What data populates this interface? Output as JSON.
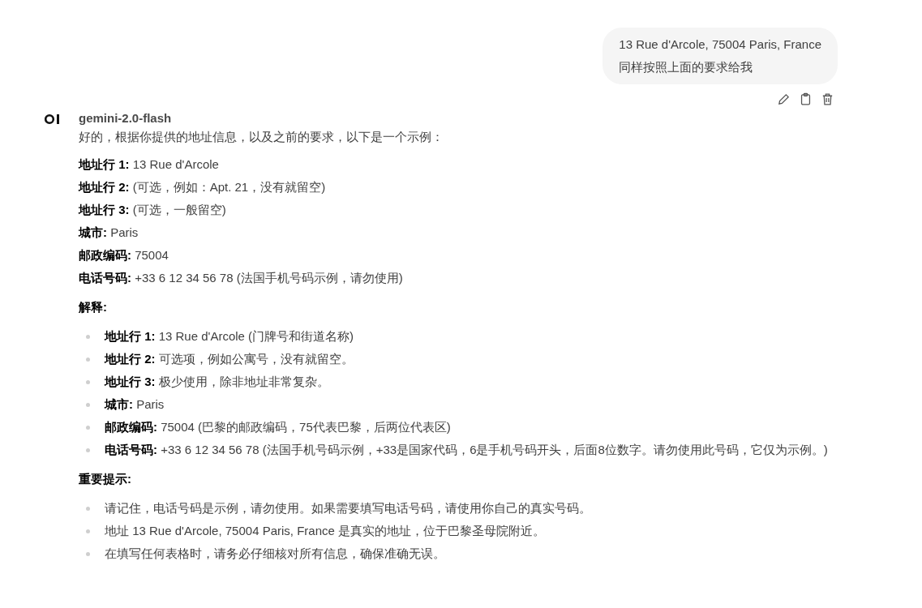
{
  "user_message": {
    "lines": [
      "13 Rue d'Arcole, 75004 Paris, France",
      "同样按照上面的要求给我"
    ]
  },
  "assistant": {
    "model": "gemini-2.0-flash",
    "intro": "好的，根据你提供的地址信息，以及之前的要求，以下是一个示例：",
    "fields": [
      "**地址行 1:** 13 Rue d'Arcole",
      "**地址行 2:** (可选，例如：Apt. 21，没有就留空)",
      "**地址行 3:** (可选，一般留空)",
      "**城市:** Paris",
      "**邮政编码:** 75004",
      "**电话号码:** +33 6 12 34 56 78 (法国手机号码示例，请勿使用)"
    ],
    "sections": [
      {
        "heading": "解释:",
        "items": [
          "**地址行 1:** 13 Rue d'Arcole (门牌号和街道名称)",
          "**地址行 2:** 可选项，例如公寓号，没有就留空。",
          "**地址行 3:** 极少使用，除非地址非常复杂。",
          "**城市:** Paris",
          "**邮政编码:** 75004 (巴黎的邮政编码，75代表巴黎，后两位代表区)",
          "**电话号码:** +33 6 12 34 56 78 (法国手机号码示例，+33是国家代码，6是手机号码开头，后面8位数字。请勿使用此号码，它仅为示例。)"
        ]
      },
      {
        "heading": "重要提示:",
        "items": [
          "请记住，电话号码是示例，请勿使用。如果需要填写电话号码，请使用你自己的真实号码。",
          "地址 13 Rue d'Arcole, 75004 Paris, France 是真实的地址，位于巴黎圣母院附近。",
          "在填写任何表格时，请务必仔细核对所有信息，确保准确无误。"
        ]
      }
    ]
  }
}
